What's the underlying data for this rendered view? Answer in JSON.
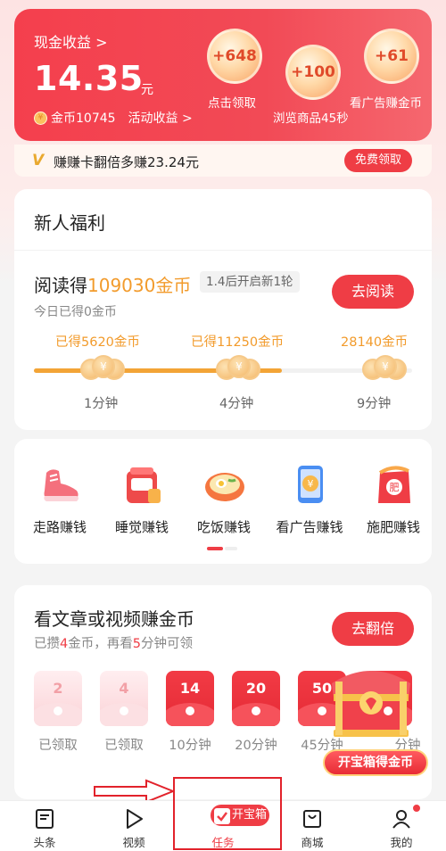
{
  "header": {
    "cash_label": "现金收益 >",
    "cash_value": "14.35",
    "cash_unit": "元",
    "coins_label": "金币10745",
    "activity_label": "活动收益 >",
    "bubbles": [
      {
        "value": "+648",
        "label": "点击领取"
      },
      {
        "value": "+100",
        "label": "浏览商品45秒"
      },
      {
        "value": "+61",
        "label": "看广告赚金币"
      }
    ]
  },
  "card_banner": {
    "icon": "V",
    "text": "赚赚卡翻倍多赚23.24元",
    "button": "免费领取"
  },
  "welfare": {
    "title": "新人福利",
    "read_prefix": "阅读得",
    "read_highlight": "109030金币",
    "round_badge": "1.4后开启新1轮",
    "today": "今日已得0金币",
    "read_button": "去阅读",
    "progress_fraction": 0.656,
    "milestones": [
      {
        "reward": "已得5620金币",
        "time": "1分钟"
      },
      {
        "reward": "已得11250金币",
        "time": "4分钟"
      },
      {
        "reward": "28140金币",
        "time": "9分钟"
      }
    ]
  },
  "grid": {
    "items": [
      {
        "label": "走路赚钱",
        "icon": "sneaker-icon",
        "color": "#f25d6b"
      },
      {
        "label": "睡觉赚钱",
        "icon": "alarm-clock-icon",
        "color": "#ee4a4a"
      },
      {
        "label": "吃饭赚钱",
        "icon": "noodle-bowl-icon",
        "color": "#f28c4a"
      },
      {
        "label": "看广告赚钱",
        "icon": "phone-coin-icon",
        "color": "#4a8ef2"
      },
      {
        "label": "施肥赚钱",
        "icon": "fertilizer-bag-icon",
        "color": "#ef3d45"
      }
    ]
  },
  "article": {
    "title": "看文章或视频赚金币",
    "sub_a": "已攒",
    "sub_n1": "4",
    "sub_b": "金币，再看",
    "sub_n2": "5",
    "sub_c": "分钟可领",
    "button": "去翻倍",
    "envelopes": [
      {
        "num": "2",
        "label": "已领取",
        "state": "claimed"
      },
      {
        "num": "4",
        "label": "已领取",
        "state": "claimed"
      },
      {
        "num": "14",
        "label": "10分钟",
        "state": "active"
      },
      {
        "num": "20",
        "label": "20分钟",
        "state": "active"
      },
      {
        "num": "50",
        "label": "45分钟",
        "state": "active"
      },
      {
        "num": "",
        "label": "分钟",
        "state": "active"
      }
    ],
    "chest_label": "开宝箱得金币"
  },
  "nav": {
    "items": [
      {
        "label": "头条",
        "icon": "news-icon"
      },
      {
        "label": "视频",
        "icon": "play-icon"
      },
      {
        "label": "任务",
        "icon": "task-check-icon"
      },
      {
        "label": "商城",
        "icon": "shopping-bag-icon"
      },
      {
        "label": "我的",
        "icon": "profile-icon"
      }
    ],
    "task_pill": "开宝箱"
  },
  "colors": {
    "brand_red": "#ef3d45",
    "coin_orange": "#f29b2c"
  }
}
